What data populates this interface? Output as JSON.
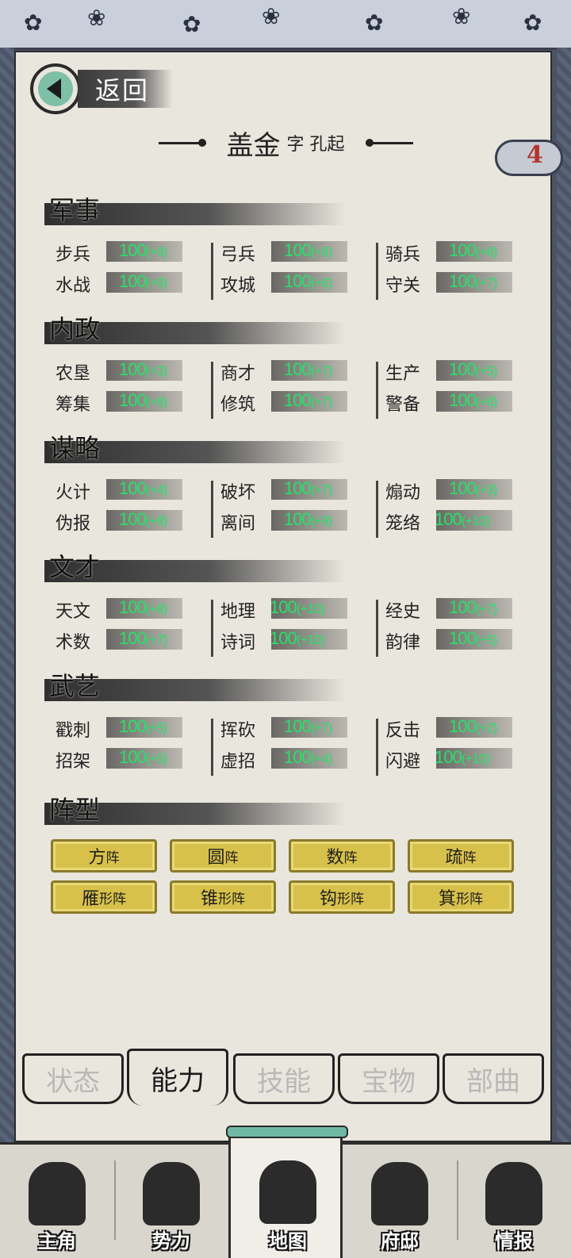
{
  "header": {
    "back_label": "返回",
    "name": "盖金",
    "courtesy": "字 孔起",
    "badge_count": "4"
  },
  "sections": [
    {
      "title": "军事",
      "rows": [
        [
          {
            "label": "步兵",
            "value": "100",
            "bonus": "(+9)"
          },
          {
            "label": "弓兵",
            "value": "100",
            "bonus": "(+8)"
          },
          {
            "label": "骑兵",
            "value": "100",
            "bonus": "(+8)"
          }
        ],
        [
          {
            "label": "水战",
            "value": "100",
            "bonus": "(+9)"
          },
          {
            "label": "攻城",
            "value": "100",
            "bonus": "(+6)"
          },
          {
            "label": "守关",
            "value": "100",
            "bonus": "(+7)"
          }
        ]
      ]
    },
    {
      "title": "内政",
      "rows": [
        [
          {
            "label": "农垦",
            "value": "100",
            "bonus": "(+3)"
          },
          {
            "label": "商才",
            "value": "100",
            "bonus": "(+7)"
          },
          {
            "label": "生产",
            "value": "100",
            "bonus": "(+5)"
          }
        ],
        [
          {
            "label": "筹集",
            "value": "100",
            "bonus": "(+8)"
          },
          {
            "label": "修筑",
            "value": "100",
            "bonus": "(+7)"
          },
          {
            "label": "警备",
            "value": "100",
            "bonus": "(+8)"
          }
        ]
      ]
    },
    {
      "title": "谋略",
      "rows": [
        [
          {
            "label": "火计",
            "value": "100",
            "bonus": "(+4)"
          },
          {
            "label": "破坏",
            "value": "100",
            "bonus": "(+7)"
          },
          {
            "label": "煽动",
            "value": "100",
            "bonus": "(+3)"
          }
        ],
        [
          {
            "label": "伪报",
            "value": "100",
            "bonus": "(+8)"
          },
          {
            "label": "离间",
            "value": "100",
            "bonus": "(+9)"
          },
          {
            "label": "笼络",
            "value": "100",
            "bonus": "(+10)"
          }
        ]
      ]
    },
    {
      "title": "文才",
      "rows": [
        [
          {
            "label": "天文",
            "value": "100",
            "bonus": "(+8)"
          },
          {
            "label": "地理",
            "value": "100",
            "bonus": "(+10)"
          },
          {
            "label": "经史",
            "value": "100",
            "bonus": "(+7)"
          }
        ],
        [
          {
            "label": "术数",
            "value": "100",
            "bonus": "(+7)"
          },
          {
            "label": "诗词",
            "value": "100",
            "bonus": "(+10)"
          },
          {
            "label": "韵律",
            "value": "100",
            "bonus": "(+5)"
          }
        ]
      ]
    },
    {
      "title": "武艺",
      "rows": [
        [
          {
            "label": "戳刺",
            "value": "100",
            "bonus": "(+5)"
          },
          {
            "label": "挥砍",
            "value": "100",
            "bonus": "(+7)"
          },
          {
            "label": "反击",
            "value": "100",
            "bonus": "(+2)"
          }
        ],
        [
          {
            "label": "招架",
            "value": "100",
            "bonus": "(+5)"
          },
          {
            "label": "虚招",
            "value": "100",
            "bonus": "(+4)"
          },
          {
            "label": "闪避",
            "value": "100",
            "bonus": "(+10)"
          }
        ]
      ]
    }
  ],
  "formation_title": "阵型",
  "formations": [
    {
      "big": "方",
      "small": "阵"
    },
    {
      "big": "圆",
      "small": "阵"
    },
    {
      "big": "数",
      "small": "阵"
    },
    {
      "big": "疏",
      "small": "阵"
    },
    {
      "big": "雁",
      "small": "形阵"
    },
    {
      "big": "锥",
      "small": "形阵"
    },
    {
      "big": "钩",
      "small": "形阵"
    },
    {
      "big": "箕",
      "small": "形阵"
    }
  ],
  "tabs": [
    "状态",
    "能力",
    "技能",
    "宝物",
    "部曲"
  ],
  "active_tab": 1,
  "bottom_nav": [
    "主角",
    "势力",
    "地图",
    "府邸",
    "情报"
  ],
  "active_nav": 2,
  "colors": {
    "stat_value": "#28e06a",
    "badge_number": "#b5352f",
    "formation_gold": "#d8c14a",
    "accent_teal": "#6fb9a4"
  }
}
